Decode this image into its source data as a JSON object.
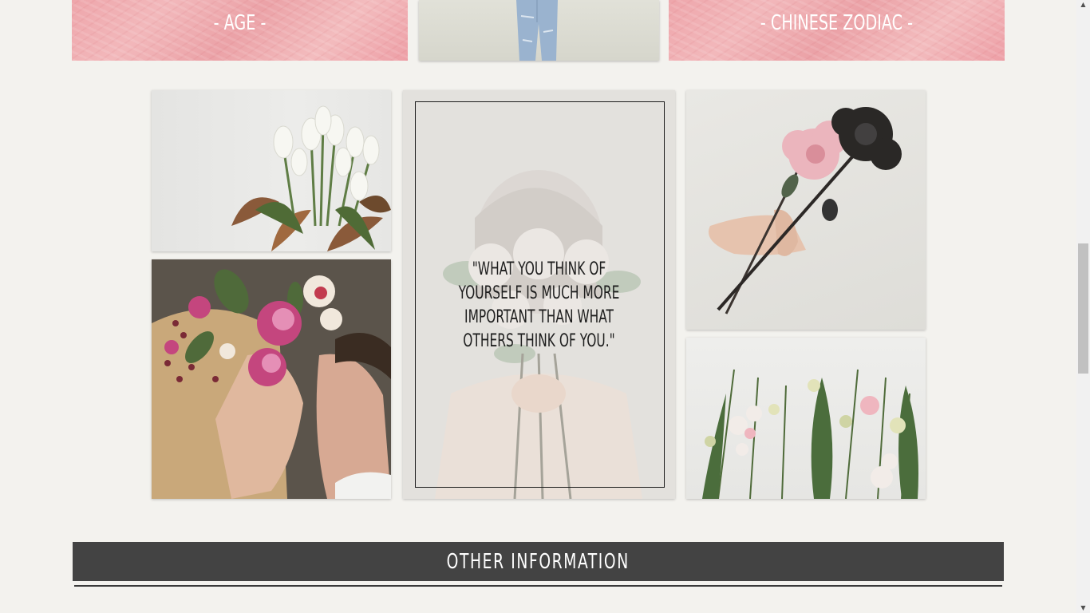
{
  "colors": {
    "background": "#f3f2ee",
    "pink_panel": "#eea6ab",
    "banner": "#434343",
    "banner_text": "#ffffff"
  },
  "top_panels": {
    "age_label": "- AGE -",
    "zodiac_label": "- CHINESE ZODIAC -"
  },
  "gallery": {
    "quote": "\"WHAT YOU THINK OF YOURSELF IS MUCH MORE IMPORTANT THAN WHAT OTHERS THINK OF YOU.\""
  },
  "section": {
    "title": "OTHER INFORMATION"
  },
  "scrollbar": {
    "up_arrow": "▲",
    "down_arrow": "▼"
  }
}
